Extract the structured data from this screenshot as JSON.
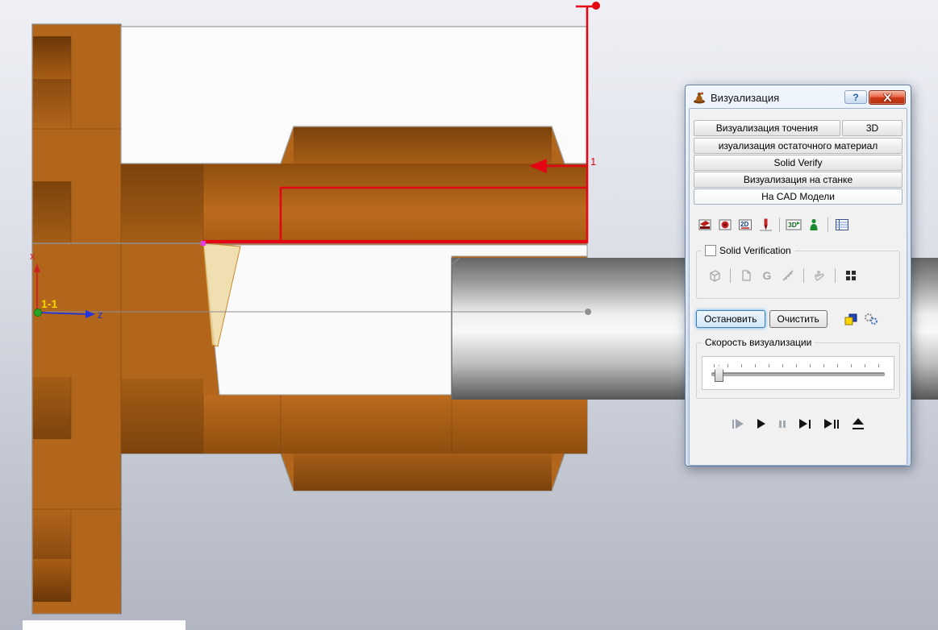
{
  "viewport": {
    "section_label": "1-1",
    "axis_z_label": "z",
    "axis_x_label": "x",
    "toolpath_step_label": "1",
    "colors": {
      "part_brown": "#b2661c",
      "toolpath_red": "#e30613",
      "residual_yellow": "#edd9a3",
      "shaft_gray": "#c9c9c9"
    }
  },
  "dialog": {
    "title": "Визуализация",
    "help_label": "?",
    "tabs": [
      "Визуализация точения",
      "3D",
      "изуализация остаточного материал",
      "Solid Verify",
      "Визуализация на станке",
      "На  CAD Модели"
    ],
    "toolbar": {
      "label_2d": "2D",
      "label_3d": "3D"
    },
    "solid_verification_label": "Solid Verification",
    "sv_icons": {
      "g_label": "G"
    },
    "stop_button": "Остановить",
    "clear_button": "Очистить",
    "speed_label": "Скорость визуализации",
    "speed_value_percent": 7
  }
}
